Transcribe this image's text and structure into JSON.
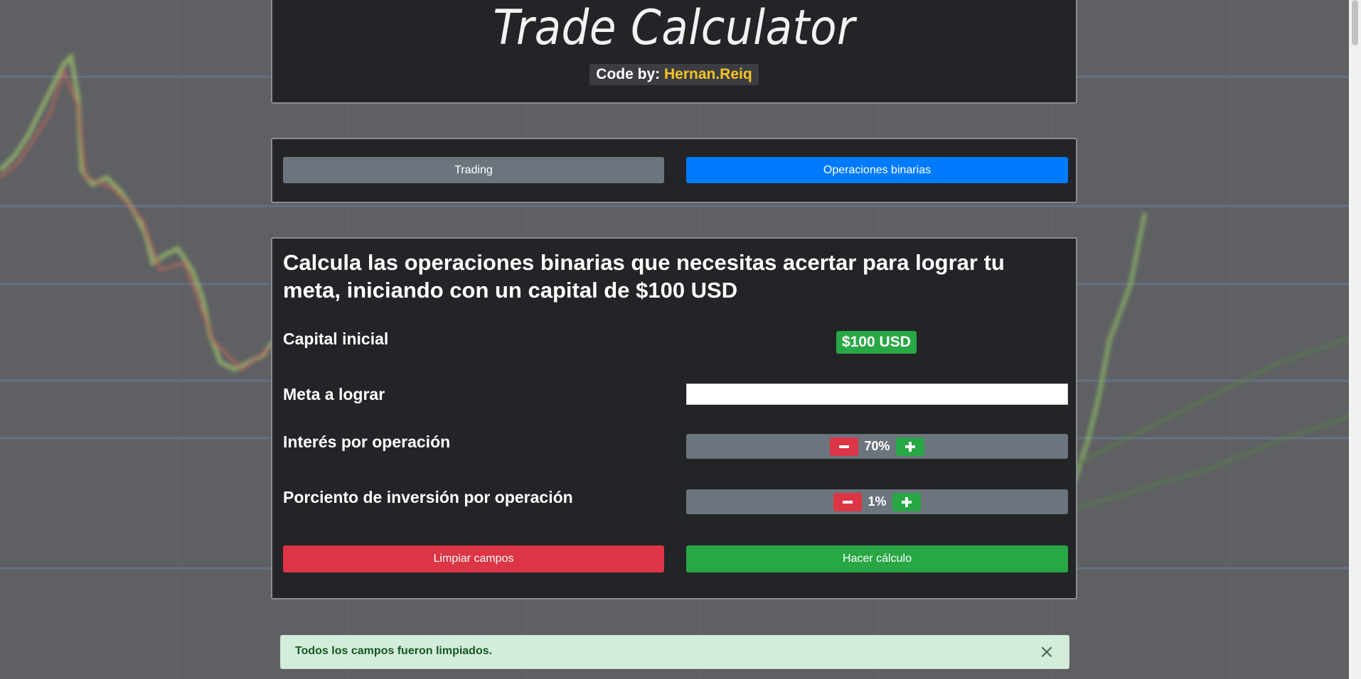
{
  "header": {
    "title": "Trade Calculator",
    "credit_label": "Code by:",
    "credit_author": "Hernan.Reiq"
  },
  "modes": {
    "trading_label": "Trading",
    "binary_label": "Operaciones binarias",
    "active": "binary"
  },
  "calculator": {
    "heading": "Calcula las operaciones binarias que necesitas acertar para lograr tu meta, iniciando con un capital de $100 USD",
    "capital_label": "Capital inicial",
    "capital_value": "$100 USD",
    "goal_label": "Meta a lograr",
    "goal_value": "",
    "interest_label": "Interés por operación",
    "interest_value": "70%",
    "investment_label": "Porciento de inversión por operación",
    "investment_value": "1%",
    "clear_label": "Limpiar campos",
    "calculate_label": "Hacer cálculo"
  },
  "alert": {
    "message": "Todos los campos fueron limpiados.",
    "close_glyph": "×"
  },
  "icons": {
    "minus": "minus-icon",
    "plus": "plus-icon",
    "close": "close-icon"
  },
  "colors": {
    "primary": "#007bff",
    "secondary": "#6c757d",
    "success": "#28a745",
    "danger": "#dc3545",
    "warning": "#f7c325",
    "panel": "#232427",
    "alert_bg": "#d4edda",
    "alert_text": "#155724"
  }
}
